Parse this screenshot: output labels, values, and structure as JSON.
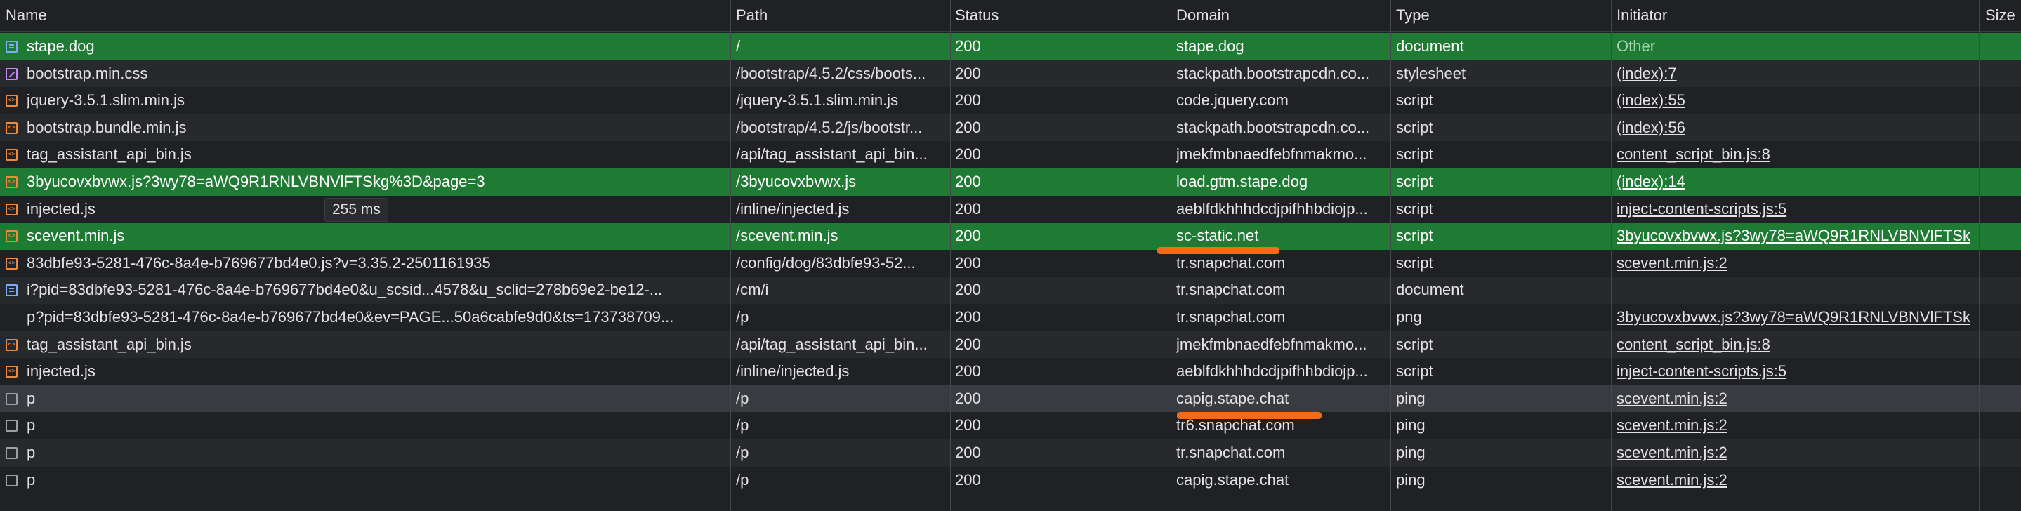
{
  "columns": {
    "name": "Name",
    "path": "Path",
    "status": "Status",
    "domain": "Domain",
    "type": "Type",
    "initiator": "Initiator",
    "size": "Size"
  },
  "tooltip": "255 ms",
  "rows": [
    {
      "name": "stape.dog",
      "path": "/",
      "status": "200",
      "domain": "stape.dog",
      "type": "document",
      "initiator": "Other",
      "icon": "document-icon"
    },
    {
      "name": "bootstrap.min.css",
      "path": "/bootstrap/4.5.2/css/boots...",
      "status": "200",
      "domain": "stackpath.bootstrapcdn.co...",
      "type": "stylesheet",
      "initiator": "(index):7",
      "icon": "stylesheet-icon"
    },
    {
      "name": "jquery-3.5.1.slim.min.js",
      "path": "/jquery-3.5.1.slim.min.js",
      "status": "200",
      "domain": "code.jquery.com",
      "type": "script",
      "initiator": "(index):55",
      "icon": "script-icon"
    },
    {
      "name": "bootstrap.bundle.min.js",
      "path": "/bootstrap/4.5.2/js/bootstr...",
      "status": "200",
      "domain": "stackpath.bootstrapcdn.co...",
      "type": "script",
      "initiator": "(index):56",
      "icon": "script-icon"
    },
    {
      "name": "tag_assistant_api_bin.js",
      "path": "/api/tag_assistant_api_bin...",
      "status": "200",
      "domain": "jmekfmbnaedfebfnmakmo...",
      "type": "script",
      "initiator": "content_script_bin.js:8",
      "icon": "script-icon"
    },
    {
      "name": "3byucovxbvwx.js?3wy78=aWQ9R1RNLVBNVlFTSkg%3D&page=3",
      "path": "/3byucovxbvwx.js",
      "status": "200",
      "domain": "load.gtm.stape.dog",
      "type": "script",
      "initiator": "(index):14",
      "icon": "script-icon"
    },
    {
      "name": "injected.js",
      "path": "/inline/injected.js",
      "status": "200",
      "domain": "aeblfdkhhhdcdjpifhhbdiojp...",
      "type": "script",
      "initiator": "inject-content-scripts.js:5",
      "icon": "script-icon"
    },
    {
      "name": "scevent.min.js",
      "path": "/scevent.min.js",
      "status": "200",
      "domain": "sc-static.net",
      "type": "script",
      "initiator": "3byucovxbvwx.js?3wy78=aWQ9R1RNLVBNVlFTSk",
      "icon": "script-icon"
    },
    {
      "name": "83dbfe93-5281-476c-8a4e-b769677bd4e0.js?v=3.35.2-2501161935",
      "path": "/config/dog/83dbfe93-52...",
      "status": "200",
      "domain": "tr.snapchat.com",
      "type": "script",
      "initiator": "scevent.min.js:2",
      "icon": "script-icon"
    },
    {
      "name": "i?pid=83dbfe93-5281-476c-8a4e-b769677bd4e0&u_scsid...4578&u_sclid=278b69e2-be12-...",
      "path": "/cm/i",
      "status": "200",
      "domain": "tr.snapchat.com",
      "type": "document",
      "initiator": "",
      "icon": "document-icon"
    },
    {
      "name": "p?pid=83dbfe93-5281-476c-8a4e-b769677bd4e0&ev=PAGE...50a6cabfe9d0&ts=173738709...",
      "path": "/p",
      "status": "200",
      "domain": "tr.snapchat.com",
      "type": "png",
      "initiator": "3byucovxbvwx.js?3wy78=aWQ9R1RNLVBNVlFTSk",
      "icon": "image-icon"
    },
    {
      "name": "tag_assistant_api_bin.js",
      "path": "/api/tag_assistant_api_bin...",
      "status": "200",
      "domain": "jmekfmbnaedfebfnmakmo...",
      "type": "script",
      "initiator": "content_script_bin.js:8",
      "icon": "script-icon"
    },
    {
      "name": "injected.js",
      "path": "/inline/injected.js",
      "status": "200",
      "domain": "aeblfdkhhhdcdjpifhhbdiojp...",
      "type": "script",
      "initiator": "inject-content-scripts.js:5",
      "icon": "script-icon"
    },
    {
      "name": "p",
      "path": "/p",
      "status": "200",
      "domain": "capig.stape.chat",
      "type": "ping",
      "initiator": "scevent.min.js:2",
      "icon": "ping-icon"
    },
    {
      "name": "p",
      "path": "/p",
      "status": "200",
      "domain": "tr6.snapchat.com",
      "type": "ping",
      "initiator": "scevent.min.js:2",
      "icon": "ping-icon"
    },
    {
      "name": "p",
      "path": "/p",
      "status": "200",
      "domain": "tr.snapchat.com",
      "type": "ping",
      "initiator": "scevent.min.js:2",
      "icon": "ping-icon"
    },
    {
      "name": "p",
      "path": "/p",
      "status": "200",
      "domain": "capig.stape.chat",
      "type": "ping",
      "initiator": "scevent.min.js:2",
      "icon": "ping-icon"
    }
  ],
  "colors": {
    "selected_row": "#1f7a33",
    "highlight_mark": "#f26b1a",
    "background": "#202124"
  }
}
